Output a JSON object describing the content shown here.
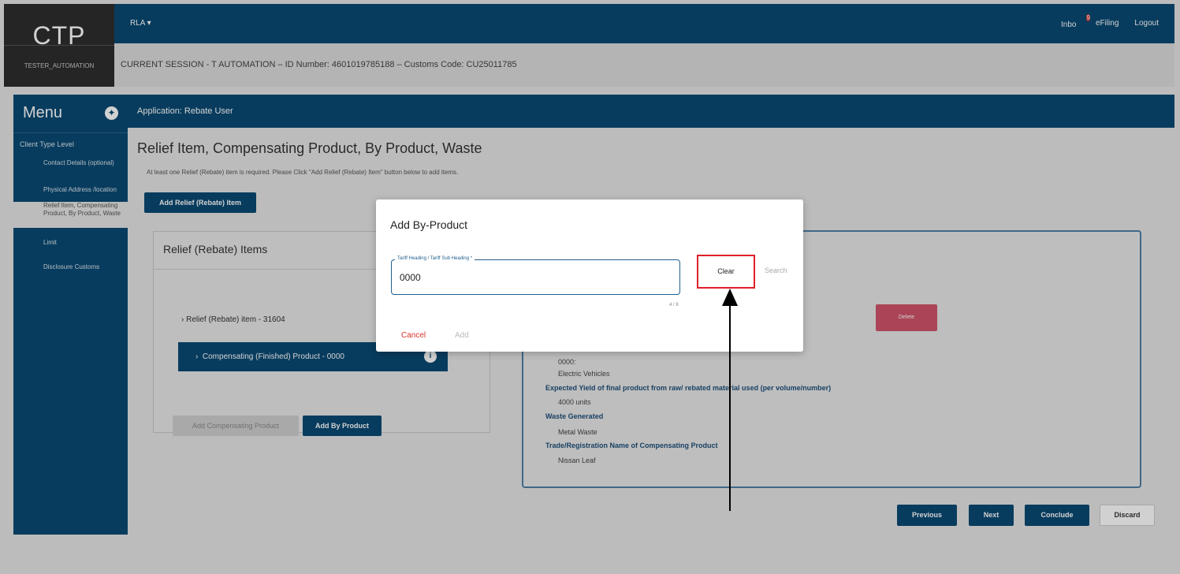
{
  "brand": {
    "logo": "CTP",
    "user": "TESTER_AUTOMATION"
  },
  "nav": {
    "rla": "RLA ▾",
    "inbox": "Inbo",
    "inbox_badge": "9",
    "efiling": "eFiling",
    "logout": "Logout"
  },
  "session": "CURRENT SESSION - T AUTOMATION – ID Number: 4601019785188 – Customs Code: CU25011785",
  "sidebar": {
    "title": "Menu",
    "level": "Client Type Level",
    "items": [
      {
        "label": "Contact Details (optional)"
      },
      {
        "label": "Physical Address /location"
      },
      {
        "label": "Relief Item, Compensating Product, By Product, Waste"
      },
      {
        "label": "Limit"
      },
      {
        "label": "Disclosure Customs"
      }
    ]
  },
  "app": {
    "appbar": "Application: Rebate User",
    "title": "Relief Item, Compensating Product, By Product, Waste",
    "hint": "At least one Relief (Rebate) item is required. Please Click \"Add Relief (Rebate) Item\" button below to add items.",
    "add_relief": "Add Relief (Rebate) Item"
  },
  "relief_card": {
    "title": "Relief (Rebate) Items",
    "item": "Relief (Rebate) item - 31604",
    "product": "Compensating (Finished) Product - 0000",
    "add_compensating": "Add Compensating Product",
    "add_by_product": "Add By Product"
  },
  "details": {
    "delete": "Delete",
    "tariff_value": "0000:",
    "tariff_desc": "Electric Vehicles",
    "yield_label": "Expected Yield of final product from raw/ rebated material used (per volume/number)",
    "yield_value": "4000 units",
    "waste_label": "Waste Generated",
    "waste_value": "Metal Waste",
    "trade_label": "Trade/Registration Name of Compensating Product",
    "trade_value": "Nissan Leaf"
  },
  "footer": {
    "previous": "Previous",
    "next": "Next",
    "conclude": "Conclude",
    "discard": "Discard"
  },
  "dialog": {
    "title": "Add By-Product",
    "field_label": "Tariff Heading / Tariff Sub Heading *",
    "field_value": "0000",
    "counter": "4 / 8",
    "clear": "Clear",
    "search": "Search",
    "cancel": "Cancel",
    "add": "Add"
  },
  "colors": {
    "primary": "#0a4a73",
    "danger": "#d9342b",
    "highlight": "#e01f2a"
  }
}
